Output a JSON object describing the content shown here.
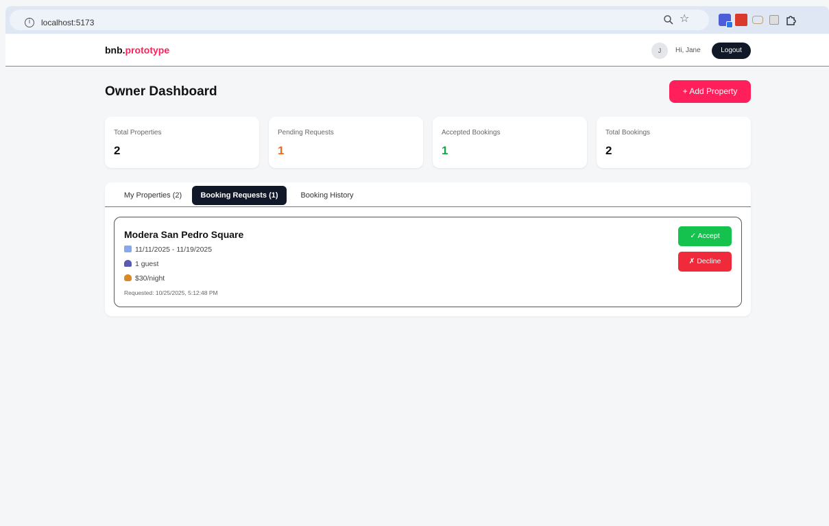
{
  "browser": {
    "url": "localhost:5173",
    "icons": [
      "info-icon",
      "zoom-icon",
      "star-icon",
      "extension-icon",
      "extension-icon",
      "extension-icon",
      "extension-icon",
      "puzzle-icon"
    ]
  },
  "header": {
    "brand_prefix": "bnb.",
    "brand_accent": "prototype",
    "avatar_initial": "J",
    "greeting": "Hi, Jane",
    "logout_label": "Logout"
  },
  "page": {
    "title": "Owner Dashboard",
    "add_property_label": "+ Add Property"
  },
  "stats": [
    {
      "label": "Total Properties",
      "value": "2",
      "color": "#111111"
    },
    {
      "label": "Pending Requests",
      "value": "1",
      "color": "#f26b1d"
    },
    {
      "label": "Accepted Bookings",
      "value": "1",
      "color": "#16a34a"
    },
    {
      "label": "Total Bookings",
      "value": "2",
      "color": "#111111"
    }
  ],
  "tabs": [
    {
      "label": "My Properties (2)",
      "active": false
    },
    {
      "label": "Booking Requests (1)",
      "active": true
    },
    {
      "label": "Booking History",
      "active": false
    }
  ],
  "booking": {
    "property_name": "Modera San Pedro Square",
    "dates": "11/11/2025 - 11/19/2025",
    "guests": "1 guest",
    "price": "$30/night",
    "requested": "Requested: 10/25/2025, 5:12:48 PM",
    "accept_label": "✓ Accept",
    "decline_label": "✗ Decline"
  },
  "colors": {
    "accent": "#ff1f5a",
    "dark": "#111827",
    "success": "#16c24e",
    "danger": "#f02a3a"
  }
}
